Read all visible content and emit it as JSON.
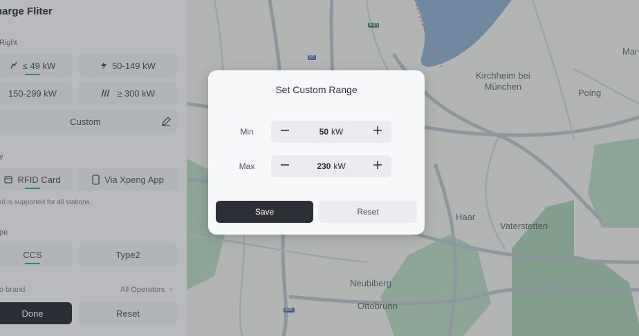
{
  "colors": {
    "accent_green": "#27b46a",
    "dark_button": "#2c3036",
    "chip_bg": "#eceef1",
    "water": "#8fb2cf",
    "forest": "#8fbf9d",
    "road": "#b9c4cb"
  },
  "panel": {
    "title": "harge Fliter",
    "power_section_label": "Right",
    "power_options": [
      {
        "label": "≤ 49 kW",
        "icon": "slow-charge-icon"
      },
      {
        "label": "50-149 kW",
        "icon": "bolt-icon"
      },
      {
        "label": "150-299 kW",
        "icon": ""
      },
      {
        "label": "≥ 300 kW",
        "icon": "ultra-charge-icon"
      }
    ],
    "custom_label": "Custom",
    "payment_section_label": "y",
    "payment_options": [
      {
        "label": "RFID Card",
        "icon": "card-icon"
      },
      {
        "label": "Via Xpeng App",
        "icon": "phone-icon"
      }
    ],
    "payment_note": "rd is supported for all stations.",
    "type_section_label": "pe",
    "type_options": [
      "CCS",
      "Type2"
    ],
    "brand_label": "o brand",
    "operators_label": "All Operators",
    "done_label": "Done",
    "reset_label": "Reset"
  },
  "map": {
    "labels": {
      "kirchheim": "Kirchheim bei\nMünchen",
      "poing": "Poing",
      "mar": "Mar",
      "haar": "Haar",
      "vaterstetten": "Vaterstetten",
      "neubiberg": "Neubiberg",
      "ottobrunn": "Ottobrunn",
      "shield_a": "E45",
      "shield_b": "99",
      "shield_c": "995"
    }
  },
  "modal": {
    "title": "Set Custom Range",
    "min": {
      "label": "Min",
      "value": "50",
      "unit": "kW"
    },
    "max": {
      "label": "Max",
      "value": "230",
      "unit": "kW"
    },
    "save_label": "Save",
    "reset_label": "Reset"
  }
}
